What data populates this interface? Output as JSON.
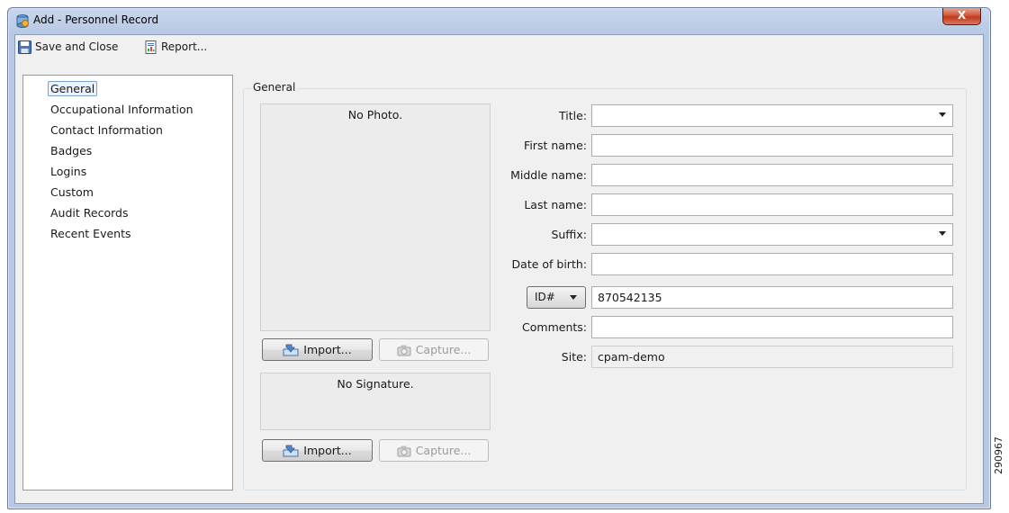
{
  "window": {
    "title": "Add - Personnel Record",
    "close_label": "X"
  },
  "toolbar": {
    "save_close_label": "Save and Close",
    "report_label": "Report..."
  },
  "nav": {
    "items": [
      {
        "label": "General",
        "selected": true
      },
      {
        "label": "Occupational Information",
        "selected": false
      },
      {
        "label": "Contact Information",
        "selected": false
      },
      {
        "label": "Badges",
        "selected": false
      },
      {
        "label": "Logins",
        "selected": false
      },
      {
        "label": "Custom",
        "selected": false
      },
      {
        "label": "Audit Records",
        "selected": false
      },
      {
        "label": "Recent Events",
        "selected": false
      }
    ]
  },
  "general": {
    "group_label": "General",
    "photo": {
      "placeholder": "No Photo.",
      "import_label": "Import...",
      "capture_label": "Capture..."
    },
    "signature": {
      "placeholder": "No Signature.",
      "import_label": "Import...",
      "capture_label": "Capture..."
    }
  },
  "form": {
    "title": {
      "label": "Title:",
      "value": ""
    },
    "first_name": {
      "label": "First name:",
      "value": ""
    },
    "middle_name": {
      "label": "Middle name:",
      "value": ""
    },
    "last_name": {
      "label": "Last name:",
      "value": ""
    },
    "suffix": {
      "label": "Suffix:",
      "value": ""
    },
    "date_of_birth": {
      "label": "Date of birth:",
      "value": ""
    },
    "id": {
      "type_selected": "ID#",
      "value": "870542135"
    },
    "comments": {
      "label": "Comments:",
      "value": ""
    },
    "site": {
      "label": "Site:",
      "value": "cpam-demo"
    }
  },
  "figure_code": "290967"
}
